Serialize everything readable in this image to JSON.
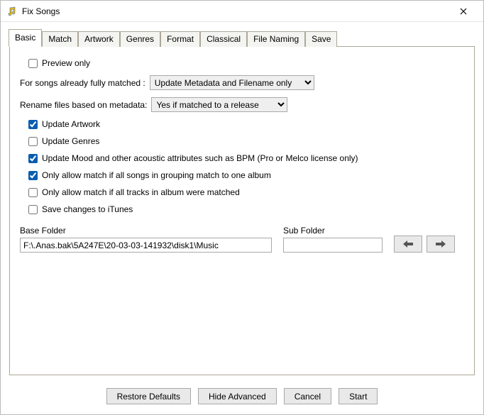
{
  "window": {
    "title": "Fix Songs"
  },
  "tabs": [
    {
      "label": "Basic"
    },
    {
      "label": "Match"
    },
    {
      "label": "Artwork"
    },
    {
      "label": "Genres"
    },
    {
      "label": "Format"
    },
    {
      "label": "Classical"
    },
    {
      "label": "File Naming"
    },
    {
      "label": "Save"
    }
  ],
  "form": {
    "preview_only": {
      "label": "Preview only",
      "checked": false
    },
    "already_matched": {
      "label": "For songs already fully matched :",
      "value": "Update Metadata and Filename only",
      "options": [
        "Update Metadata and Filename only"
      ]
    },
    "rename_files": {
      "label": "Rename files based on metadata:",
      "value": "Yes if matched to a release",
      "options": [
        "Yes if matched to a release"
      ]
    },
    "update_artwork": {
      "label": "Update Artwork",
      "checked": true
    },
    "update_genres": {
      "label": "Update Genres",
      "checked": false
    },
    "update_mood": {
      "label": "Update Mood and other acoustic attributes such as BPM (Pro or Melco license only)",
      "checked": true
    },
    "only_group_match": {
      "label": "Only allow match if all songs in grouping match to one album",
      "checked": true
    },
    "only_album_match": {
      "label": "Only allow match if all tracks in album were matched",
      "checked": false
    },
    "save_itunes": {
      "label": "Save changes to iTunes",
      "checked": false
    },
    "base_folder": {
      "label": "Base Folder",
      "value": "F:\\.Anas.bak\\5A247E\\20-03-03-141932\\disk1\\Music"
    },
    "sub_folder": {
      "label": "Sub Folder",
      "value": ""
    }
  },
  "buttons": {
    "restore": "Restore Defaults",
    "hide_advanced": "Hide Advanced",
    "cancel": "Cancel",
    "start": "Start"
  }
}
